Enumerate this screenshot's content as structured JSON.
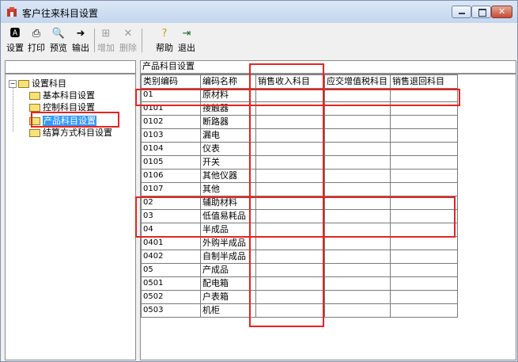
{
  "window": {
    "title": "客户往来科目设置"
  },
  "toolbar": {
    "settings": "设置",
    "print": "打印",
    "preview": "预览",
    "export": "输出",
    "add": "增加",
    "delete": "删除",
    "help": "帮助",
    "exit": "退出"
  },
  "tree": {
    "root": "设置科目",
    "items": [
      "基本科目设置",
      "控制科目设置",
      "产品科目设置",
      "结算方式科目设置"
    ],
    "selected": "产品科目设置"
  },
  "grid": {
    "caption": "产品科目设置",
    "columns": [
      "类别编码",
      "编码名称",
      "销售收入科目",
      "应交增值税科目",
      "销售退回科目"
    ],
    "rows": [
      [
        "01",
        "原材料"
      ],
      [
        "0101",
        "接触器"
      ],
      [
        "0102",
        "断路器"
      ],
      [
        "0103",
        "漏电"
      ],
      [
        "0104",
        "仪表"
      ],
      [
        "0105",
        "开关"
      ],
      [
        "0106",
        "其他仪器"
      ],
      [
        "0107",
        "其他"
      ],
      [
        "02",
        "辅助材料"
      ],
      [
        "03",
        "低值易耗品"
      ],
      [
        "04",
        "半成品"
      ],
      [
        "0401",
        "外购半成品"
      ],
      [
        "0402",
        "自制半成品"
      ],
      [
        "05",
        "产成品"
      ],
      [
        "0501",
        "配电箱"
      ],
      [
        "0502",
        "户表箱"
      ],
      [
        "0503",
        "机柜"
      ]
    ]
  },
  "colors": {
    "highlight": "#e8231f",
    "selection": "#3399ff"
  }
}
